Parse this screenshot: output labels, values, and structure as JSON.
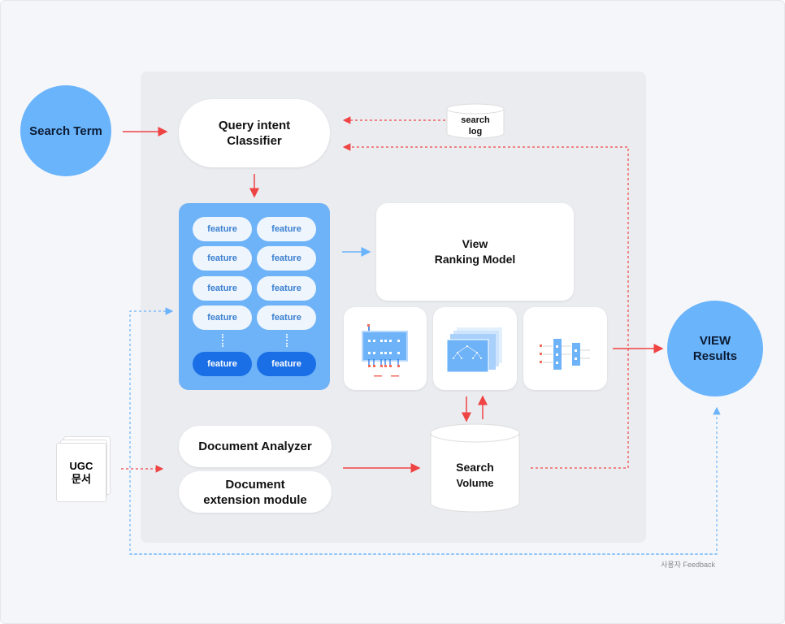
{
  "nodes": {
    "search_term": "Search Term",
    "query_classifier": [
      "Query intent",
      "Classifier"
    ],
    "search_log": [
      "search",
      "log"
    ],
    "features": [
      "feature",
      "feature",
      "feature",
      "feature",
      "feature",
      "feature",
      "feature",
      "feature"
    ],
    "features_bottom": [
      "feature",
      "feature"
    ],
    "ranking_model": [
      "View",
      "Ranking Model"
    ],
    "view_results": [
      "VIEW",
      "Results"
    ],
    "ugc_docs": [
      "UGC",
      "문서"
    ],
    "document_analyzer": "Document Analyzer",
    "document_extension": [
      "Document",
      "extension module"
    ],
    "search_volume": [
      "Search",
      "Volume"
    ]
  },
  "feedback_label": "사용자 Feedback",
  "colors": {
    "accent_blue": "#6ab4fc",
    "dark_blue": "#1a6fe6",
    "arrow_red": "#ef4444",
    "dash_blue": "#6ab4fc",
    "panel": "#ebecf0"
  },
  "icons": [
    "neural-network-icon",
    "decision-tree-stack-icon",
    "layered-network-icon"
  ]
}
